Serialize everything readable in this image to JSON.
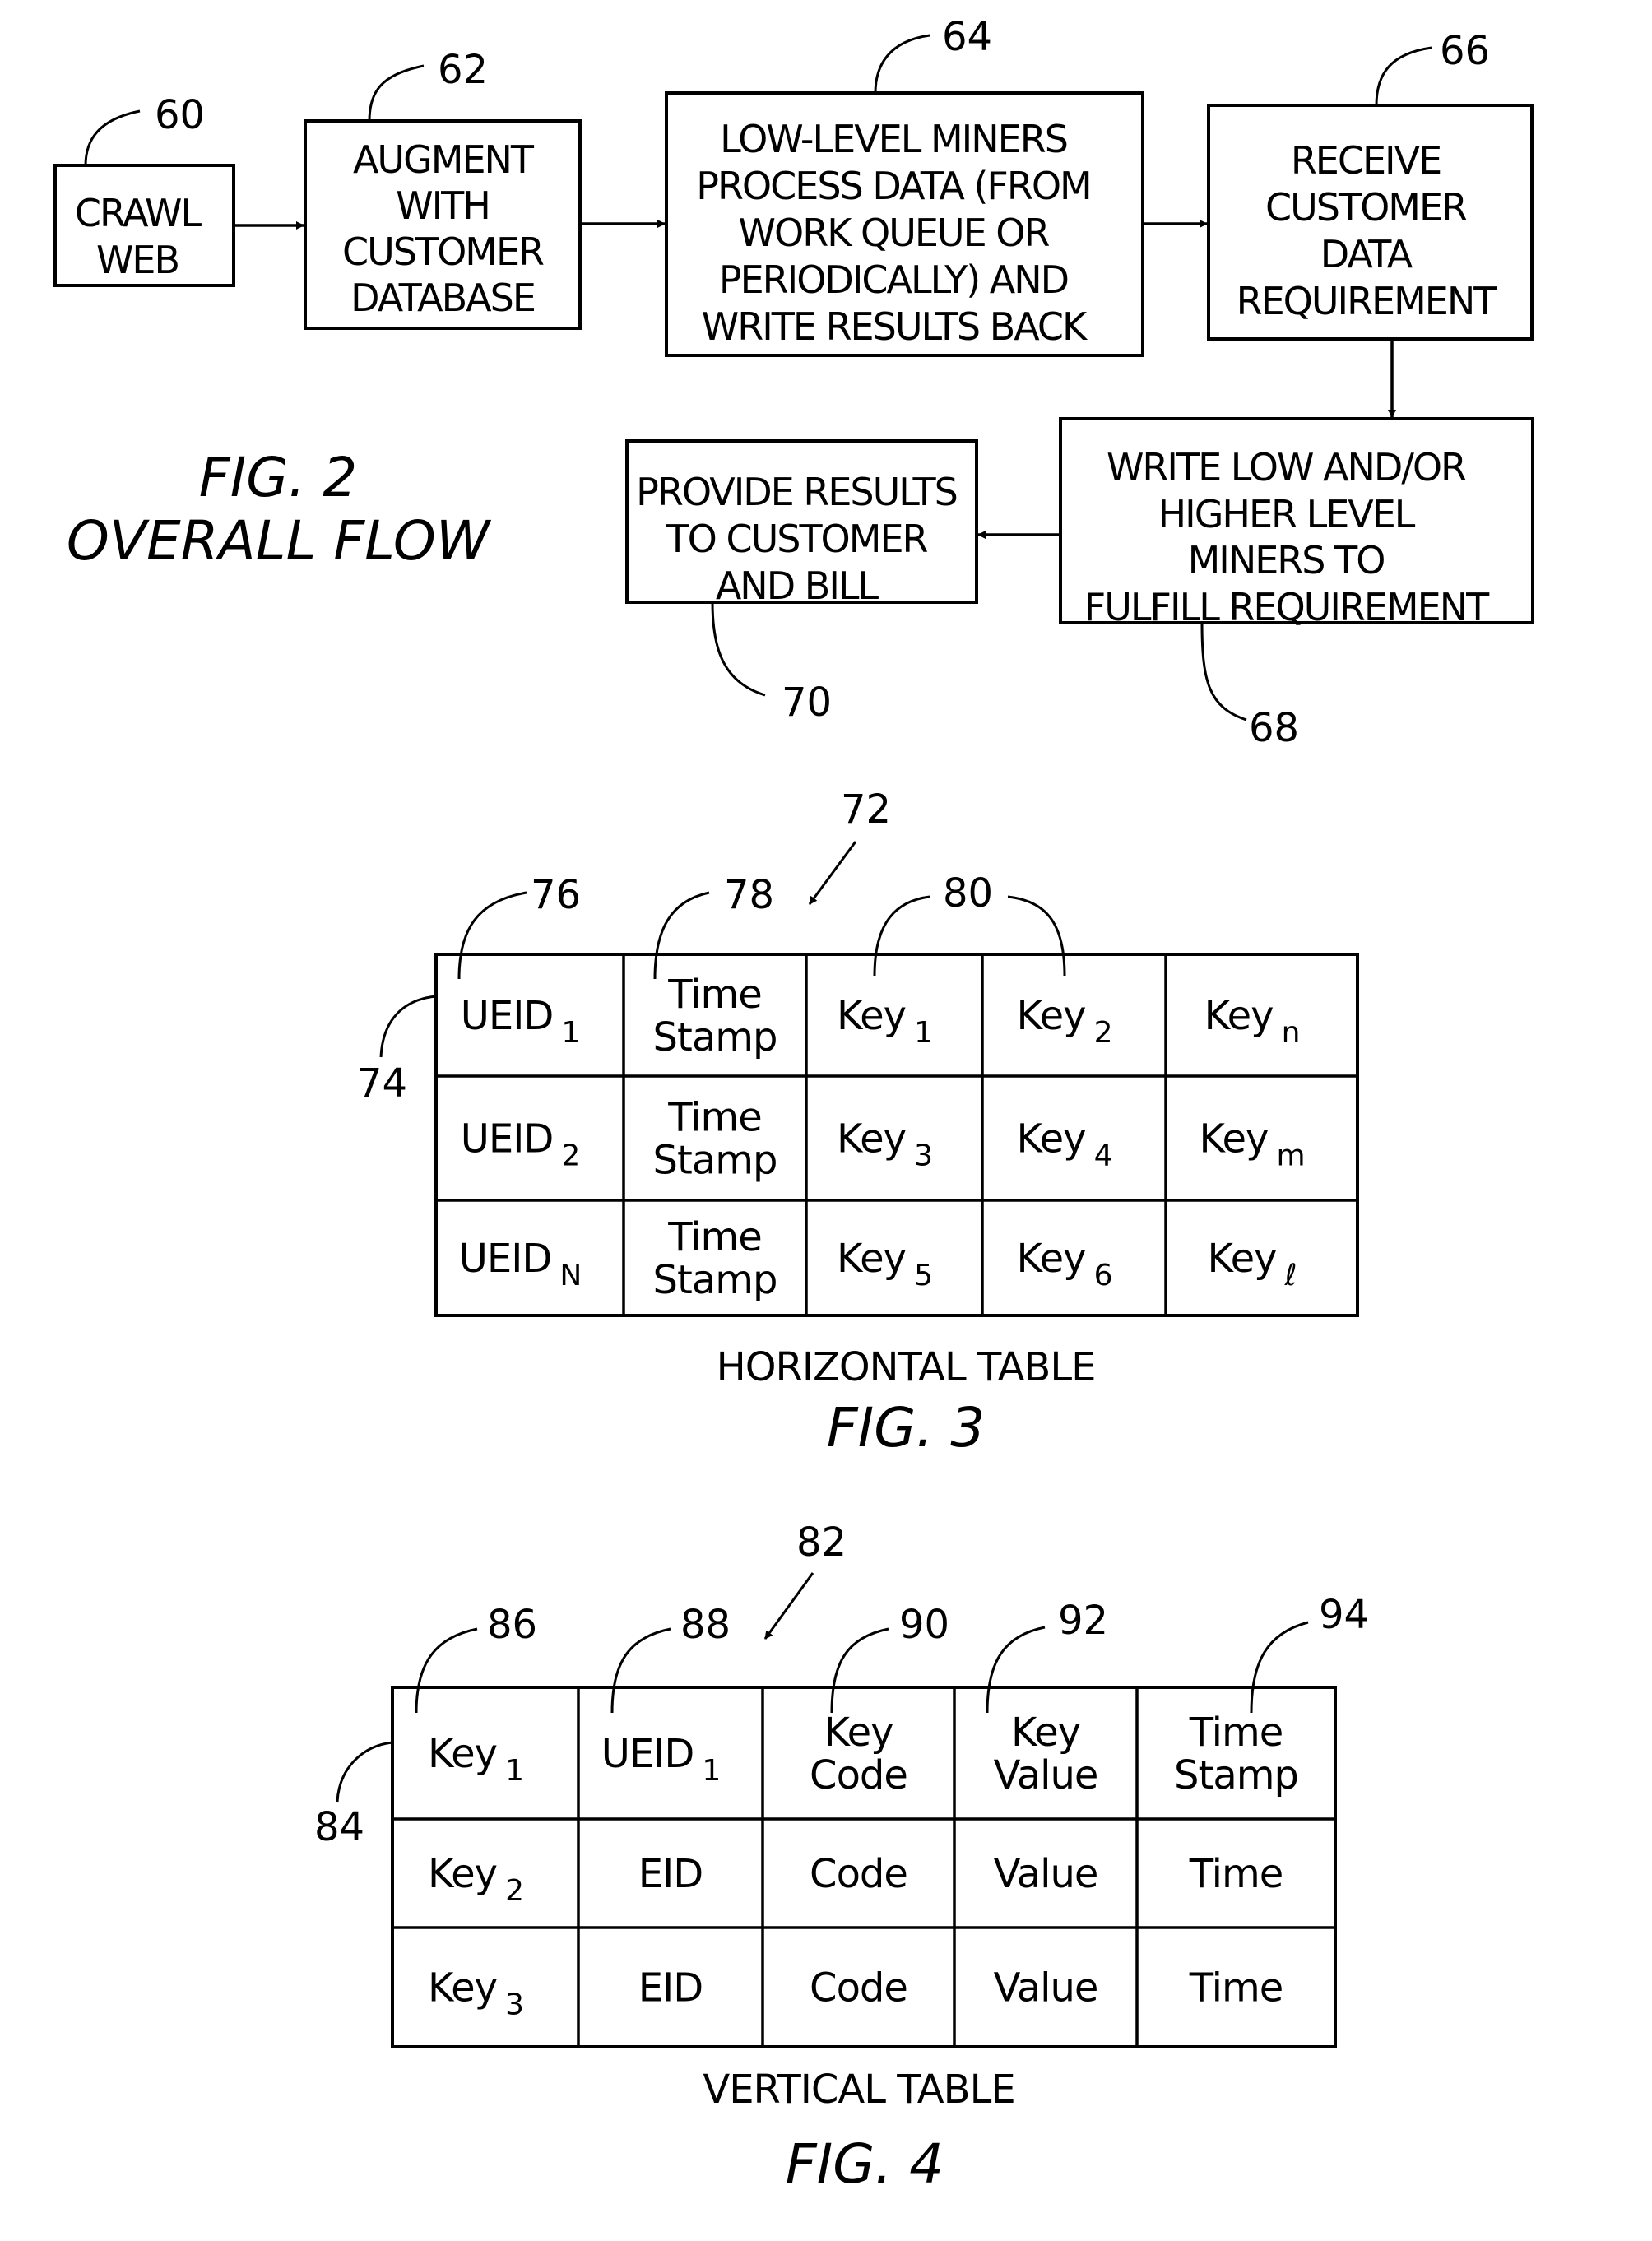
{
  "figure2": {
    "title": "FIG. 2",
    "subtitle": "OVERALL FLOW",
    "steps": [
      {
        "ref": "60",
        "lines": [
          "CRAWL",
          "WEB"
        ]
      },
      {
        "ref": "62",
        "lines": [
          "AUGMENT",
          "WITH",
          "CUSTOMER",
          "DATABASE"
        ]
      },
      {
        "ref": "64",
        "lines": [
          "LOW-LEVEL MINERS",
          "PROCESS DATA (FROM",
          "WORK QUEUE OR",
          "PERIODICALLY) AND",
          "WRITE RESULTS BACK"
        ]
      },
      {
        "ref": "66",
        "lines": [
          "RECEIVE",
          "CUSTOMER",
          "DATA",
          "REQUIREMENT"
        ]
      },
      {
        "ref": "68",
        "lines": [
          "WRITE LOW AND/OR",
          "HIGHER LEVEL",
          "MINERS TO",
          "FULFILL REQUIREMENT"
        ]
      },
      {
        "ref": "70",
        "lines": [
          "PROVIDE RESULTS",
          "TO CUSTOMER",
          "AND BILL"
        ]
      }
    ]
  },
  "figure3": {
    "title": "FIG. 3",
    "caption": "HORIZONTAL TABLE",
    "refs": {
      "table": "72",
      "row": "74",
      "col_ueid": "76",
      "col_timestamp": "78",
      "col_keys": "80"
    },
    "rows": [
      [
        {
          "t": [
            "UEID"
          ],
          "s": "1"
        },
        {
          "t": [
            "Time",
            "Stamp"
          ],
          "s": ""
        },
        {
          "t": [
            "Key"
          ],
          "s": "1"
        },
        {
          "t": [
            "Key"
          ],
          "s": "2"
        },
        {
          "t": [
            "Key"
          ],
          "s": "n"
        }
      ],
      [
        {
          "t": [
            "UEID"
          ],
          "s": "2"
        },
        {
          "t": [
            "Time",
            "Stamp"
          ],
          "s": ""
        },
        {
          "t": [
            "Key"
          ],
          "s": "3"
        },
        {
          "t": [
            "Key"
          ],
          "s": "4"
        },
        {
          "t": [
            "Key"
          ],
          "s": "m"
        }
      ],
      [
        {
          "t": [
            "UEID"
          ],
          "s": "N"
        },
        {
          "t": [
            "Time",
            "Stamp"
          ],
          "s": ""
        },
        {
          "t": [
            "Key"
          ],
          "s": "5"
        },
        {
          "t": [
            "Key"
          ],
          "s": "6"
        },
        {
          "t": [
            "Key"
          ],
          "s": "ℓ"
        }
      ]
    ]
  },
  "figure4": {
    "title": "FIG. 4",
    "caption": "VERTICAL TABLE",
    "refs": {
      "table": "82",
      "row": "84",
      "col_key": "86",
      "col_ueid": "88",
      "col_code": "90",
      "col_value": "92",
      "col_timestamp": "94"
    },
    "rows": [
      [
        {
          "t": [
            "Key"
          ],
          "s": "1"
        },
        {
          "t": [
            "UEID"
          ],
          "s": "1"
        },
        {
          "t": [
            "Key",
            "Code"
          ],
          "s": ""
        },
        {
          "t": [
            "Key",
            "Value"
          ],
          "s": ""
        },
        {
          "t": [
            "Time",
            "Stamp"
          ],
          "s": ""
        }
      ],
      [
        {
          "t": [
            "Key"
          ],
          "s": "2"
        },
        {
          "t": [
            "EID"
          ],
          "s": ""
        },
        {
          "t": [
            "Code"
          ],
          "s": ""
        },
        {
          "t": [
            "Value"
          ],
          "s": ""
        },
        {
          "t": [
            "Time"
          ],
          "s": ""
        }
      ],
      [
        {
          "t": [
            "Key"
          ],
          "s": "3"
        },
        {
          "t": [
            "EID"
          ],
          "s": ""
        },
        {
          "t": [
            "Code"
          ],
          "s": ""
        },
        {
          "t": [
            "Value"
          ],
          "s": ""
        },
        {
          "t": [
            "Time"
          ],
          "s": ""
        }
      ]
    ]
  }
}
